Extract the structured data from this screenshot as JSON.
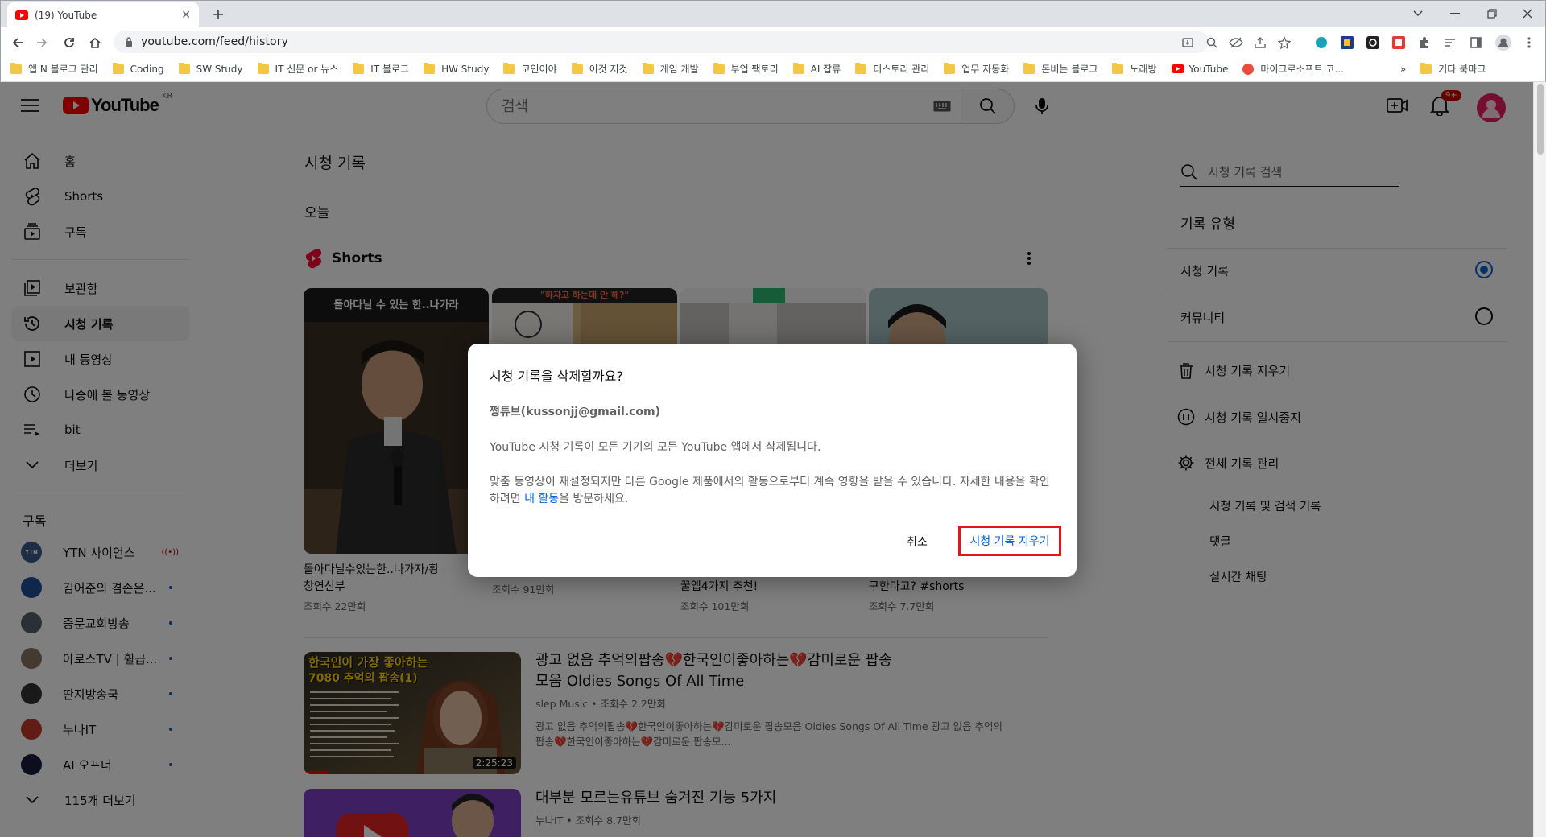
{
  "browser": {
    "tab_title": "(19) YouTube",
    "url": "youtube.com/feed/history",
    "bookmarks": [
      "앱 N 블로그 관리",
      "Coding",
      "SW Study",
      "IT 신문 or 뉴스",
      "IT 블로그",
      "HW Study",
      "코인이야",
      "이것 저것",
      "게임 개발",
      "부업 팩토리",
      "AI 잡류",
      "티스토리 관리",
      "업무 자동화",
      "돈버는 블로그",
      "노래방",
      "YouTube",
      "마이크로소프트 코...",
      "»",
      "기타 북마크"
    ]
  },
  "masthead": {
    "logo_text": "YouTube",
    "region": "KR",
    "search_placeholder": "검색",
    "notification_badge": "9+"
  },
  "guide": {
    "main": [
      "홈",
      "Shorts",
      "구독"
    ],
    "library": [
      "보관함",
      "시청 기록",
      "내 동영상",
      "나중에 볼 동영상",
      "bit",
      "더보기"
    ],
    "subs_title": "구독",
    "subscriptions": [
      {
        "name": "YTN 사이언스",
        "avatar_text": "YTN",
        "color": "#3a5a8c"
      },
      {
        "name": "김어준의 겸손은...",
        "avatar_text": "",
        "color": "#1f4e9a"
      },
      {
        "name": "중문교회방송",
        "avatar_text": "",
        "color": "#56616e"
      },
      {
        "name": "아로스TV | 휠급...",
        "avatar_text": "",
        "color": "#8a7560"
      },
      {
        "name": "딴지방송국",
        "avatar_text": "",
        "color": "#333333"
      },
      {
        "name": "누나IT",
        "avatar_text": "",
        "color": "#c0392b"
      },
      {
        "name": "AI 오프너",
        "avatar_text": "",
        "color": "#1b1d3a"
      }
    ],
    "more_subs": "115개 더보기"
  },
  "main": {
    "page_title": "시청 기록",
    "today": "오늘",
    "shorts_label": "Shorts",
    "shorts": [
      {
        "title_line1": "돌아다닐수있는한..나가자/황",
        "title_line2": "창연신부",
        "views": "조회수 22만회"
      },
      {
        "title_line1": "",
        "title_line2": "",
        "views": "조회수 91만회"
      },
      {
        "title_line1": "",
        "title_line2": "꿀앱4가지 추천!",
        "views": "조회수 101만회"
      },
      {
        "title_line1": "",
        "title_line2": "구한다고? #shorts",
        "views": "조회수 7.7만회"
      }
    ],
    "short_captions": [
      "돌아다닐 수 있는 한..나가라",
      "\"하자고 하는데 안 해?\"",
      "",
      ""
    ],
    "videos": [
      {
        "title_line1": "광고 없음 추억의팝송💔한국인이좋아하는💔감미로운 팝송",
        "title_line2": "모음 Oldies Songs Of All Time",
        "channel": "slep Music",
        "views": "조회수 2.2만회",
        "desc_line1": "광고 없음 추억의팝송💔한국인이좋아하는💔감미로운 팝송모음 Oldies Songs Of All Time 광고 없음 추억의",
        "desc_line2": "팝송💔한국인이좋아하는💔감미로운 팝송모...",
        "duration": "2:25:23",
        "thumb_line1": "한국인이 가장 좋아하는",
        "thumb_line2": "7080 추억의 팝송(1)"
      },
      {
        "title_line1": "대부분 모르는유튜브 숨겨진 기능 5가지",
        "channel": "누나IT",
        "views": "조회수 8.7만회"
      }
    ]
  },
  "right_panel": {
    "search_placeholder": "시청 기록 검색",
    "history_type": "기록 유형",
    "options": [
      "시청 기록",
      "커뮤니티"
    ],
    "actions": [
      "시청 기록 지우기",
      "시청 기록 일시중지",
      "전체 기록 관리"
    ],
    "sub_links": [
      "시청 기록 및 검색 기록",
      "댓글",
      "실시간 채팅"
    ]
  },
  "dialog": {
    "title": "시청 기록을 삭제할까요?",
    "account": "쩡튜브(kussonjj@gmail.com)",
    "p1": "YouTube 시청 기록이 모든 기기의 모든 YouTube 앱에서 삭제됩니다.",
    "p2_a": "맞춤 동영상이 재설정되지만 다른 Google 제품에서의 활동으로부터 계속 영향을 받을 수 있습니다. 자세한 내용을 확인하려면 ",
    "p2_link": "내 활동",
    "p2_b": "을 방문하세요.",
    "cancel": "취소",
    "confirm": "시청 기록 지우기"
  }
}
